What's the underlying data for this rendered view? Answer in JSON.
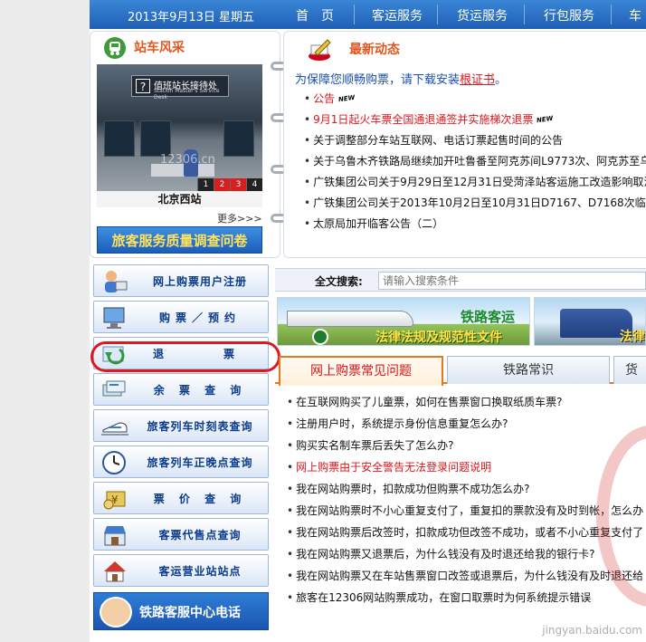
{
  "topnav": {
    "date": "2013年9月13日 星期五",
    "items": [
      "首　页",
      "客运服务",
      "货运服务",
      "行包服务",
      "车"
    ]
  },
  "station": {
    "title": "站车风采",
    "sign_text": "值班站长接待处",
    "sign_en": "Station Master's Service Desk",
    "pages": [
      "1",
      "2",
      "3",
      "4"
    ],
    "watermark": "12306.cn",
    "caption": "北京西站",
    "more": "更多>>>",
    "banner": "旅客服务质量调查问卷"
  },
  "news": {
    "title": "最新动态",
    "notice_prefix": "为保障您顺畅购票，请下载安装",
    "notice_link": "根证书",
    "notice_suffix": "。",
    "new_badge": "NEW",
    "items": [
      {
        "text": "公告",
        "red": true,
        "new": true
      },
      {
        "text": "9月1日起火车票全国通退通签并实施梯次退票",
        "red": true,
        "new": true
      },
      {
        "text": "关于调整部分车站互联网、电话订票起售时间的公告",
        "red": false,
        "new": false
      },
      {
        "text": "关于乌鲁木齐铁路局继续加开吐鲁番至阿克苏间L9773次、阿克苏至乌",
        "red": false,
        "new": false
      },
      {
        "text": "广铁集团公司关于9月29日至12月31日受菏泽站客运施工改造影响取消",
        "red": false,
        "new": false
      },
      {
        "text": "广铁集团公司关于2013年10月2日至10月31日D7167、D7168次临",
        "red": false,
        "new": false
      },
      {
        "text": "太原局加开临客公告（二）",
        "red": false,
        "new": false
      }
    ]
  },
  "menu": {
    "items": [
      {
        "label": "网上购票用户注册",
        "icon": "user-register-icon"
      },
      {
        "label": "购票／预约",
        "icon": "computer-icon"
      },
      {
        "label": "退　　票",
        "icon": "return-arrow-icon"
      },
      {
        "label": "余 票 查 询",
        "icon": "ticket-stack-icon"
      },
      {
        "label": "旅客列车时刻表查询",
        "icon": "bullet-train-icon"
      },
      {
        "label": "旅客列车正晚点查询",
        "icon": "clock-icon"
      },
      {
        "label": "票 价 查 询",
        "icon": "money-icon"
      },
      {
        "label": "客票代售点查询",
        "icon": "shop-icon"
      },
      {
        "label": "客运营业站站点",
        "icon": "house-icon"
      }
    ],
    "hotline": "铁路客服中心电话"
  },
  "search": {
    "label": "全文搜索:",
    "placeholder": "请输入搜索条件"
  },
  "law": {
    "title": "铁路客运",
    "subtitle": "法律法规及规范性文件",
    "title2": "法律"
  },
  "tabs": [
    "网上购票常见问题",
    "铁路常识",
    "货"
  ],
  "faq": [
    {
      "text": "在互联网购买了儿童票，如何在售票窗口换取纸质车票?",
      "red": false
    },
    {
      "text": "注册用户时，系统提示身份信息重复怎么办?",
      "red": false
    },
    {
      "text": "购买实名制车票后丢失了怎么办?",
      "red": false
    },
    {
      "text": "网上购票由于安全警告无法登录问题说明",
      "red": true
    },
    {
      "text": "我在网站购票时，扣款成功但购票不成功怎么办?",
      "red": false
    },
    {
      "text": "我在网站购票时不小心重复支付了，重复扣的票款没有及时到帐，怎么办",
      "red": false
    },
    {
      "text": "我在网站购票后改签时，扣款成功但改签不成功，或者不小心重复支付了",
      "red": false
    },
    {
      "text": "我在网站购票又退票后，为什么钱没有及时退还给我的银行卡?",
      "red": false
    },
    {
      "text": "我在网站购票又在车站售票窗口改签或退票后，为什么钱没有及时退还给",
      "red": false
    },
    {
      "text": "旅客在12306网站购票成功，在窗口取票时为何系统提示错误",
      "red": false
    }
  ],
  "footer_watermark": "jingyan.baidu.com",
  "colors": {
    "accent": "#1f5fb6",
    "orange": "#e0561e",
    "red": "#d8161b",
    "highlight_circle": "#e0181e"
  }
}
